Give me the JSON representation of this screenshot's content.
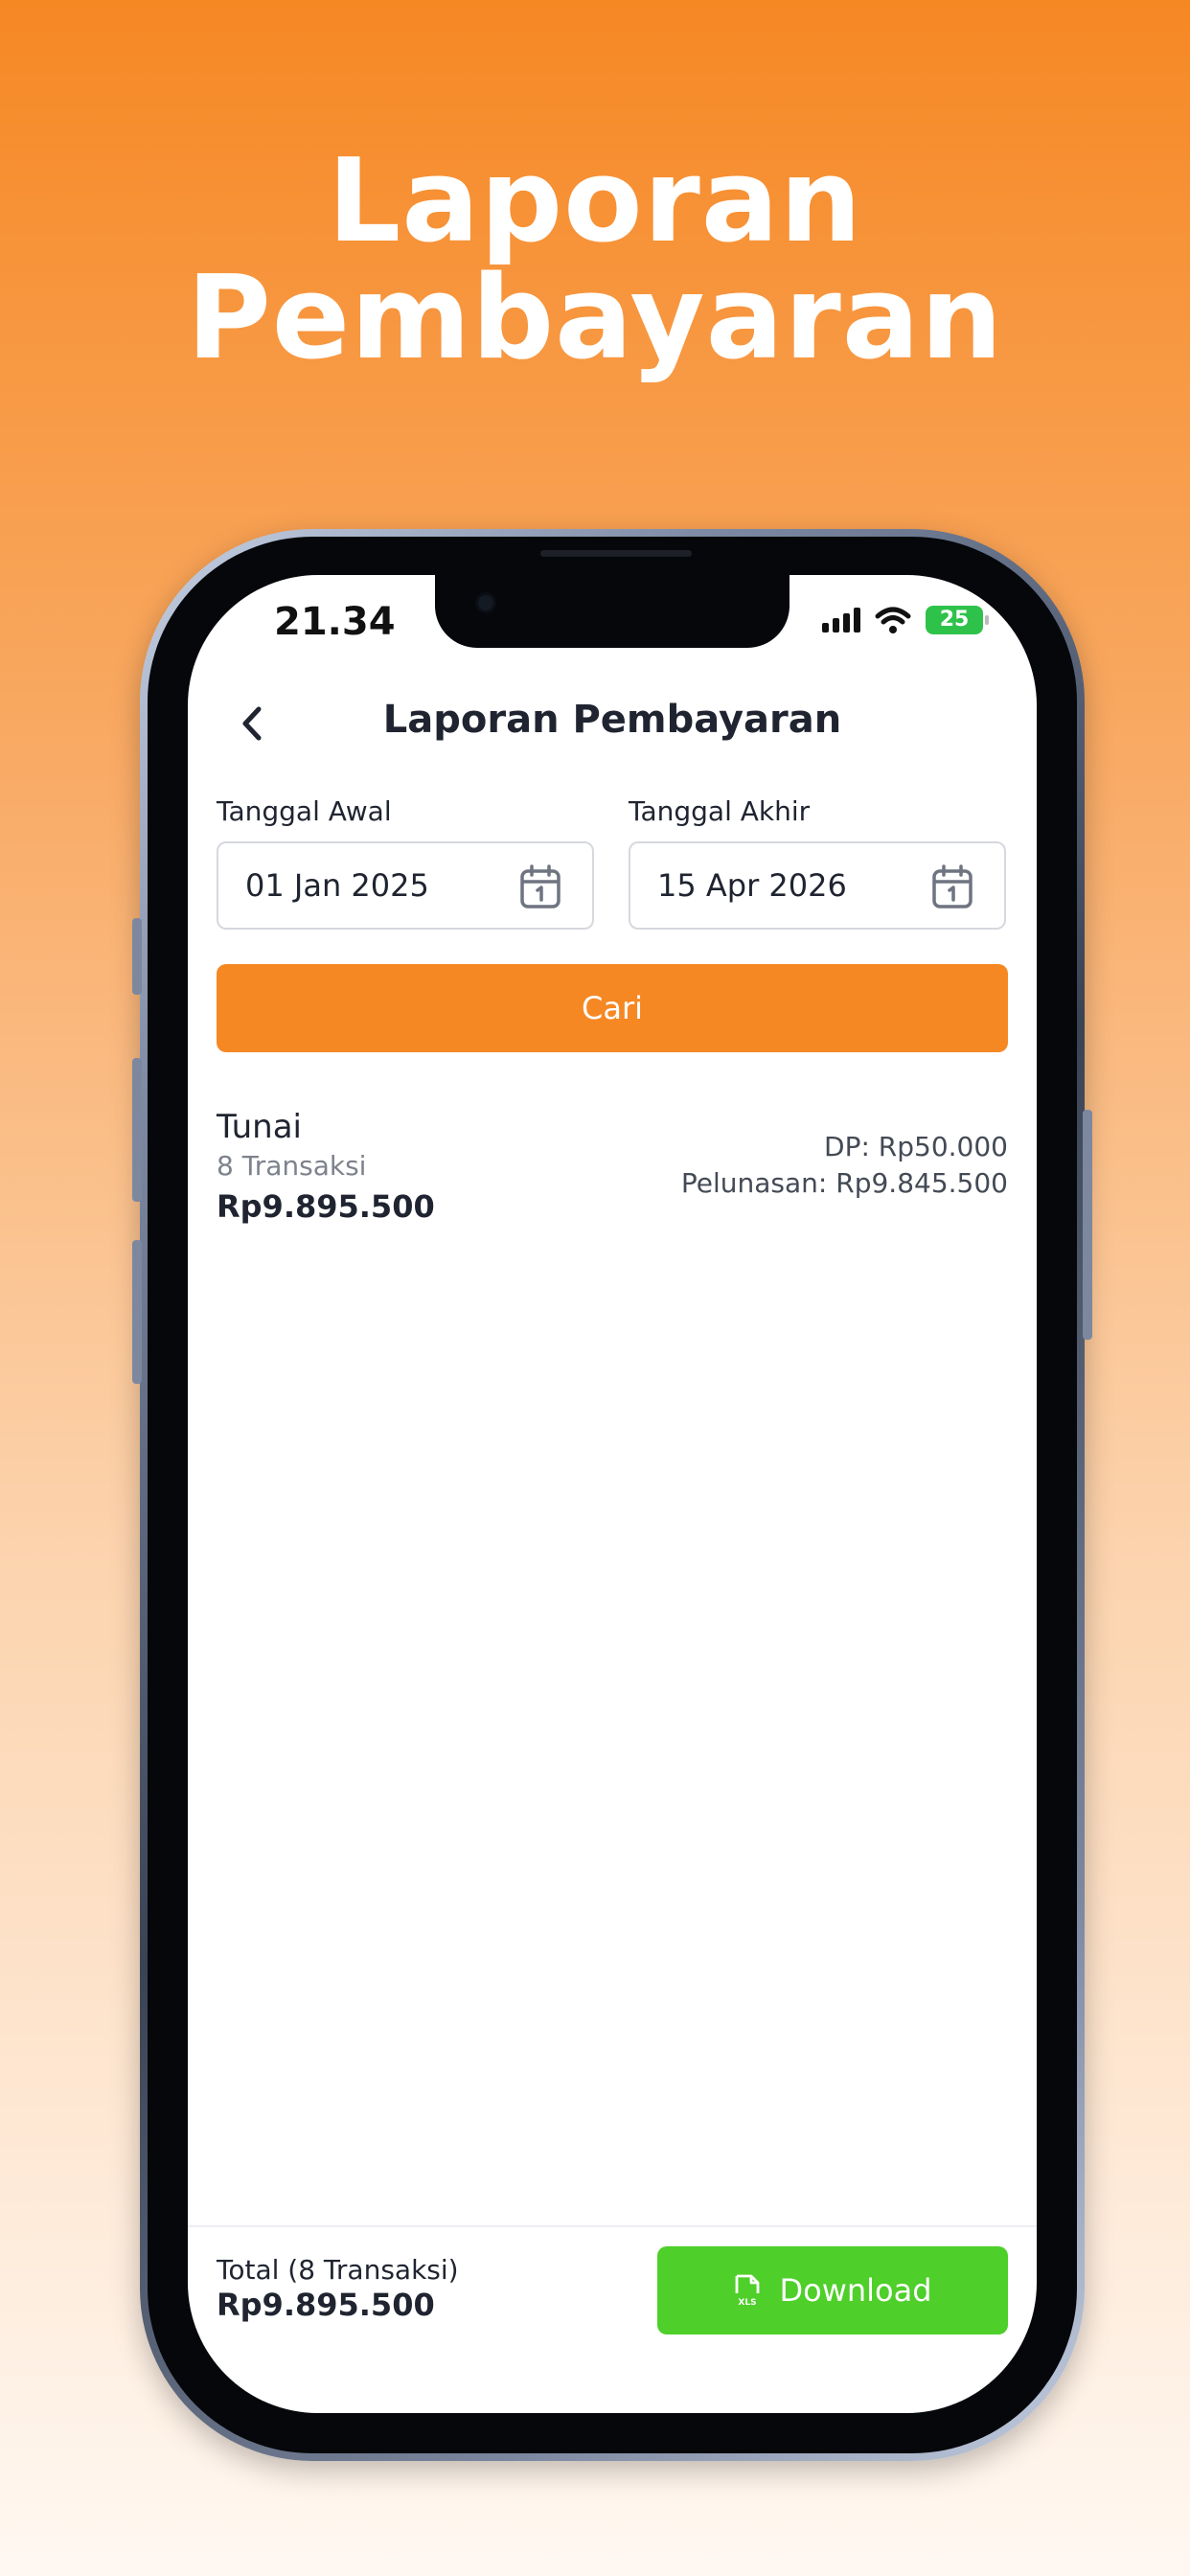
{
  "hero": {
    "line1": "Laporan",
    "line2": "Pembayaran"
  },
  "status_bar": {
    "time": "21.34",
    "battery": "25"
  },
  "header": {
    "title": "Laporan Pembayaran"
  },
  "filters": {
    "start_label": "Tanggal Awal",
    "start_value": "01 Jan 2025",
    "end_label": "Tanggal Akhir",
    "end_value": "15 Apr 2026",
    "search_label": "Cari"
  },
  "payments": [
    {
      "method": "Tunai",
      "count": "8 Transaksi",
      "amount": "Rp9.895.500",
      "dp": "DP: Rp50.000",
      "pelunasan": "Pelunasan: Rp9.845.500"
    }
  ],
  "footer": {
    "total_label": "Total (8 Transaksi)",
    "total_amount": "Rp9.895.500",
    "download_label": "Download"
  },
  "colors": {
    "accent": "#f68824",
    "download": "#4ecf2a",
    "battery": "#2fc24b"
  },
  "icons": [
    "back-icon",
    "calendar-icon",
    "xls-file-icon",
    "signal-icon",
    "wifi-icon",
    "battery-icon"
  ]
}
